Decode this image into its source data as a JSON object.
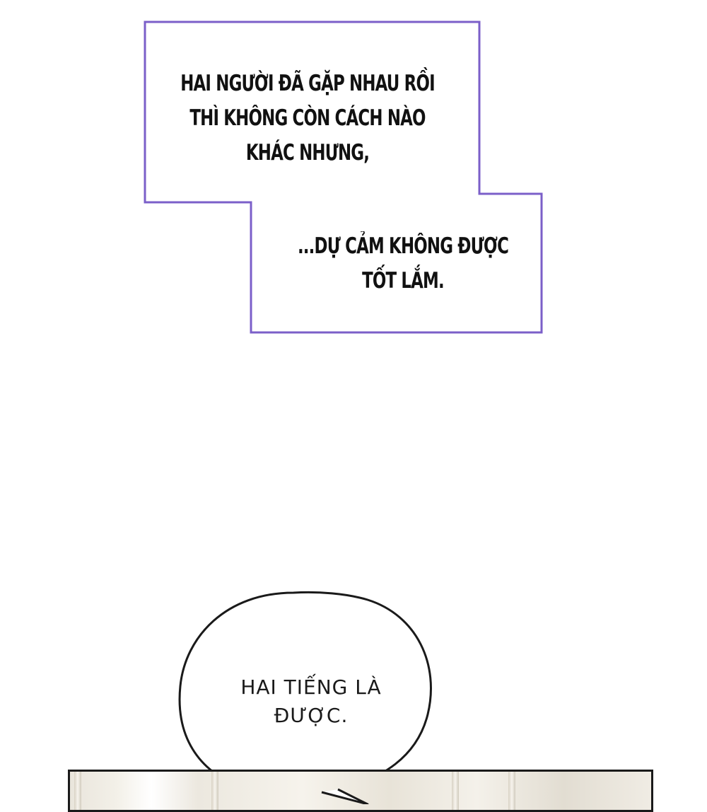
{
  "narration": {
    "box1_lines": [
      "HAI NGƯỜI ĐÃ GẶP NHAU RỒI",
      "THÌ KHÔNG CÒN CÁCH NÀO",
      "KHÁC NHƯNG,"
    ],
    "box2_lines": [
      "...DỰ CẢM KHÔNG ĐƯỢC",
      "TỐT LẮM."
    ],
    "border_color": "#7b5fc9"
  },
  "speech_bubble": {
    "lines": [
      "HAI TIẾNG LÀ",
      "ĐƯỢC."
    ],
    "stroke_color": "#1a1a1a"
  }
}
